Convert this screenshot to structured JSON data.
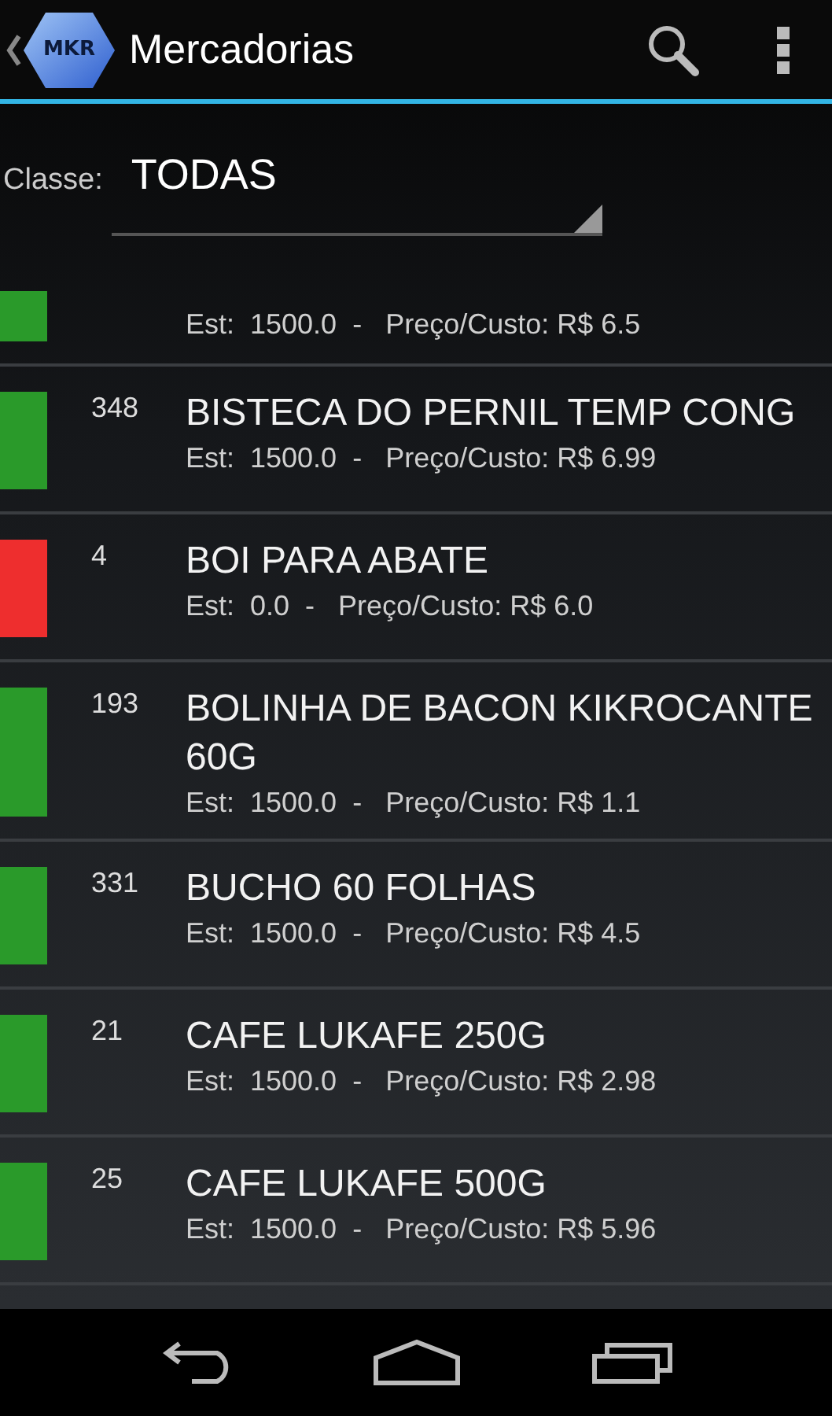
{
  "action_bar": {
    "logo_text": "MKR",
    "title": "Mercadorias"
  },
  "filter": {
    "label": "Classe:",
    "value": "TODAS"
  },
  "items": [
    {
      "details": "Est:  1500.0  -   Preço/Custo: R$ 6.5",
      "color": "#2a9a2a"
    },
    {
      "code": "348",
      "name": "BISTECA DO PERNIL TEMP CONG",
      "details": "Est:  1500.0  -   Preço/Custo: R$ 6.99",
      "color": "#2a9a2a"
    },
    {
      "code": "4",
      "name": "BOI PARA ABATE",
      "details": "Est:  0.0  -   Preço/Custo: R$ 6.0",
      "color": "#ee2e2e"
    },
    {
      "code": "193",
      "name": "BOLINHA DE BACON KIKROCANTE 60G",
      "details": "Est:  1500.0  -   Preço/Custo: R$ 1.1",
      "color": "#2a9a2a"
    },
    {
      "code": "331",
      "name": "BUCHO 60 FOLHAS",
      "details": "Est:  1500.0  -   Preço/Custo: R$ 4.5",
      "color": "#2a9a2a"
    },
    {
      "code": "21",
      "name": "CAFE LUKAFE 250G",
      "details": "Est:  1500.0  -   Preço/Custo: R$ 2.98",
      "color": "#2a9a2a"
    },
    {
      "code": "25",
      "name": "CAFE LUKAFE 500G",
      "details": "Est:  1500.0  -   Preço/Custo: R$ 5.96",
      "color": "#2a9a2a"
    }
  ]
}
